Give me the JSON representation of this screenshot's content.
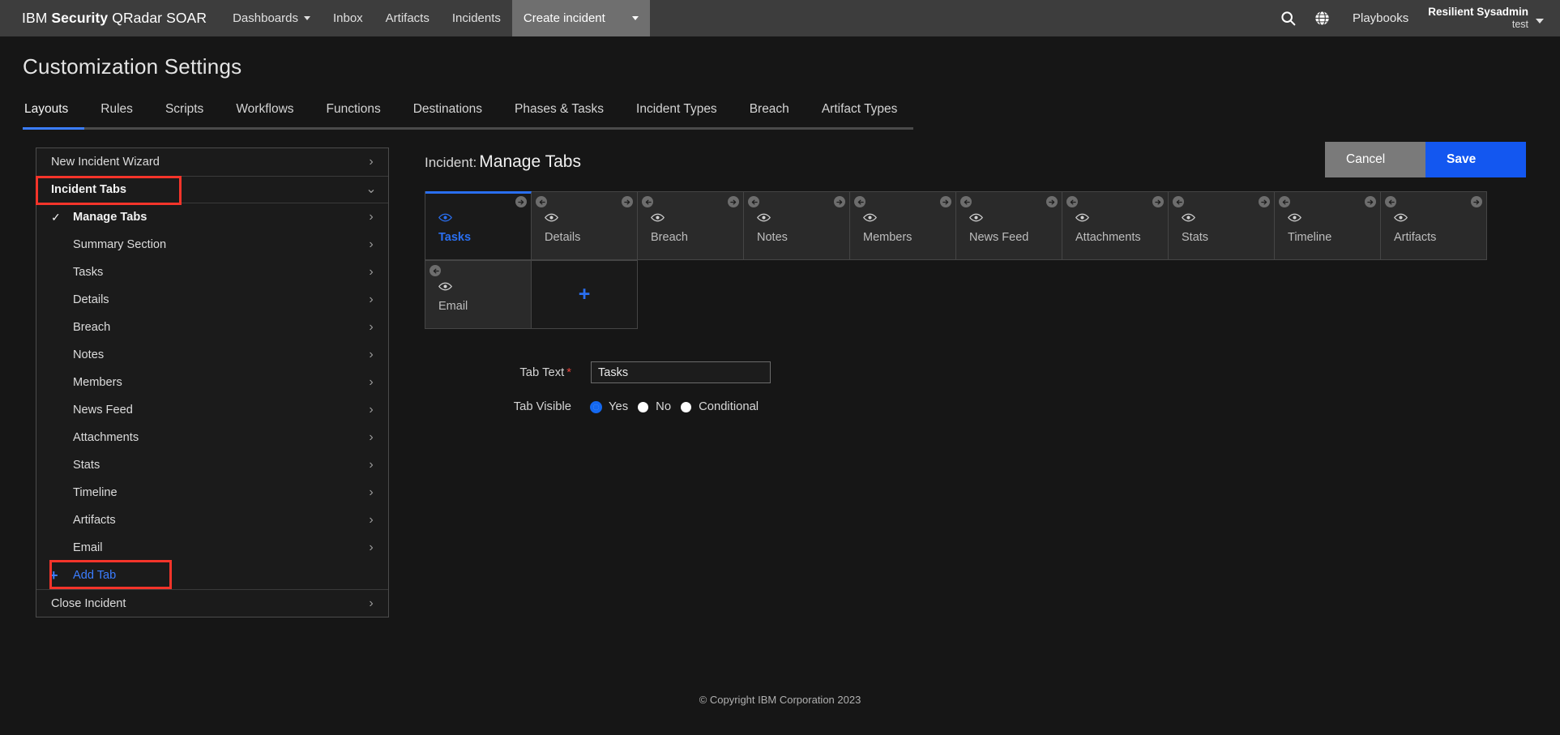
{
  "header": {
    "brand_ibm": "IBM",
    "brand_security": "Security",
    "brand_product": "QRadar SOAR",
    "nav": [
      {
        "label": "Dashboards",
        "has_caret": true,
        "active": false
      },
      {
        "label": "Inbox",
        "has_caret": false,
        "active": false
      },
      {
        "label": "Artifacts",
        "has_caret": false,
        "active": false
      },
      {
        "label": "Incidents",
        "has_caret": false,
        "active": false
      },
      {
        "label": "Create incident",
        "has_caret": true,
        "active": true
      }
    ],
    "search_icon": "search-icon",
    "globe_icon": "globe-icon",
    "playbooks_label": "Playbooks",
    "user_name": "Resilient Sysadmin",
    "user_org": "test"
  },
  "page": {
    "title": "Customization Settings",
    "tabs": [
      {
        "label": "Layouts",
        "active": true
      },
      {
        "label": "Rules",
        "active": false
      },
      {
        "label": "Scripts",
        "active": false
      },
      {
        "label": "Workflows",
        "active": false
      },
      {
        "label": "Functions",
        "active": false
      },
      {
        "label": "Destinations",
        "active": false
      },
      {
        "label": "Phases & Tasks",
        "active": false
      },
      {
        "label": "Incident Types",
        "active": false
      },
      {
        "label": "Breach",
        "active": false
      },
      {
        "label": "Artifact Types",
        "active": false
      }
    ]
  },
  "sidebar": {
    "items": [
      {
        "label": "New Incident Wizard",
        "chevron": "right",
        "style": "plain"
      },
      {
        "label": "Incident Tabs",
        "chevron": "down",
        "style": "bold-divided",
        "highlighted": true
      },
      {
        "label": "Manage Tabs",
        "chevron": "right",
        "style": "bold-check"
      },
      {
        "label": "Summary Section",
        "chevron": "right",
        "style": "indent"
      },
      {
        "label": "Tasks",
        "chevron": "right",
        "style": "indent"
      },
      {
        "label": "Details",
        "chevron": "right",
        "style": "indent"
      },
      {
        "label": "Breach",
        "chevron": "right",
        "style": "indent"
      },
      {
        "label": "Notes",
        "chevron": "right",
        "style": "indent"
      },
      {
        "label": "Members",
        "chevron": "right",
        "style": "indent"
      },
      {
        "label": "News Feed",
        "chevron": "right",
        "style": "indent"
      },
      {
        "label": "Attachments",
        "chevron": "right",
        "style": "indent"
      },
      {
        "label": "Stats",
        "chevron": "right",
        "style": "indent"
      },
      {
        "label": "Timeline",
        "chevron": "right",
        "style": "indent"
      },
      {
        "label": "Artifacts",
        "chevron": "right",
        "style": "indent"
      },
      {
        "label": "Email",
        "chevron": "right",
        "style": "indent"
      },
      {
        "label": "Add Tab",
        "chevron": "none",
        "style": "add",
        "highlighted": true
      },
      {
        "label": "Close Incident",
        "chevron": "right",
        "style": "plain-top"
      }
    ]
  },
  "main": {
    "title_prefix": "Incident:",
    "title_main": "Manage Tabs",
    "cancel_label": "Cancel",
    "save_label": "Save",
    "cards": [
      {
        "label": "Tasks",
        "active": true,
        "left_arrow": false,
        "right_arrow": true
      },
      {
        "label": "Details",
        "active": false,
        "left_arrow": true,
        "right_arrow": true
      },
      {
        "label": "Breach",
        "active": false,
        "left_arrow": true,
        "right_arrow": true
      },
      {
        "label": "Notes",
        "active": false,
        "left_arrow": true,
        "right_arrow": true
      },
      {
        "label": "Members",
        "active": false,
        "left_arrow": true,
        "right_arrow": true
      },
      {
        "label": "News Feed",
        "active": false,
        "left_arrow": true,
        "right_arrow": true
      },
      {
        "label": "Attachments",
        "active": false,
        "left_arrow": true,
        "right_arrow": true
      },
      {
        "label": "Stats",
        "active": false,
        "left_arrow": true,
        "right_arrow": true
      },
      {
        "label": "Timeline",
        "active": false,
        "left_arrow": true,
        "right_arrow": true
      },
      {
        "label": "Artifacts",
        "active": false,
        "left_arrow": true,
        "right_arrow": true
      },
      {
        "label": "Email",
        "active": false,
        "left_arrow": true,
        "right_arrow": false
      }
    ],
    "add_card_glyph": "+",
    "form": {
      "tab_text_label": "Tab Text",
      "tab_text_required": "*",
      "tab_text_value": "Tasks",
      "tab_visible_label": "Tab Visible",
      "tab_visible_options": [
        {
          "label": "Yes",
          "selected": true
        },
        {
          "label": "No",
          "selected": false
        },
        {
          "label": "Conditional",
          "selected": false
        }
      ]
    }
  },
  "footer": {
    "copyright": "© Copyright IBM Corporation 2023"
  },
  "colors": {
    "accent_blue": "#1468f0",
    "highlight_red": "#f5342a",
    "header_bg": "#3d3d3d",
    "page_bg": "#161616"
  }
}
